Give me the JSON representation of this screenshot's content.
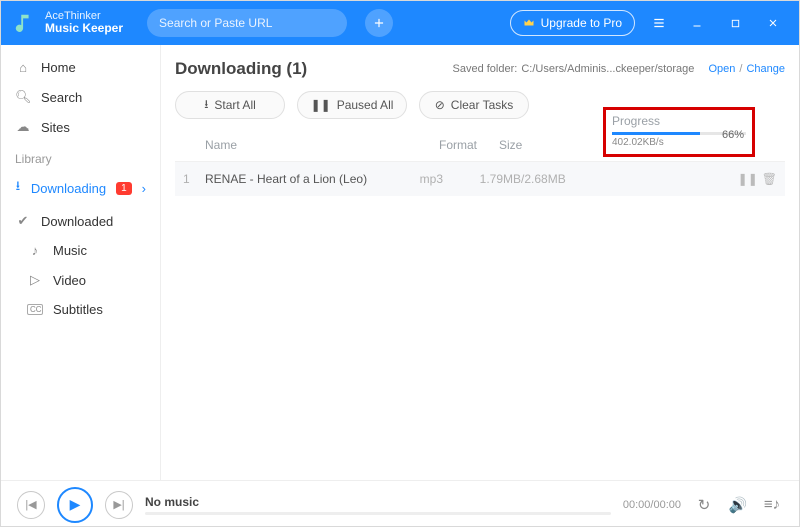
{
  "brand": {
    "line1": "AceThinker",
    "line2": "Music Keeper"
  },
  "search": {
    "placeholder": "Search or Paste URL"
  },
  "titlebar": {
    "upgrade": "Upgrade to Pro"
  },
  "sidebar": {
    "home": "Home",
    "search": "Search",
    "sites": "Sites",
    "library_label": "Library",
    "downloading": "Downloading",
    "downloading_badge": "1",
    "downloaded": "Downloaded",
    "music": "Music",
    "video": "Video",
    "subtitles": "Subtitles"
  },
  "page": {
    "title": "Downloading (1)",
    "saved_label": "Saved folder:",
    "saved_path": "C:/Users/Adminis...ckeeper/storage",
    "open": "Open",
    "change": "Change"
  },
  "toolbar": {
    "start_all": "Start All",
    "paused_all": "Paused All",
    "clear_tasks": "Clear Tasks"
  },
  "columns": {
    "name": "Name",
    "format": "Format",
    "size": "Size",
    "progress": "Progress"
  },
  "rows": [
    {
      "idx": "1",
      "name": "RENAE - Heart of a Lion (Leo)",
      "format": "mp3",
      "size": "1.79MB/2.68MB",
      "percent": "66%",
      "percent_width": "66%",
      "speed": "402.02KB/s"
    }
  ],
  "player": {
    "track": "No music",
    "time": "00:00/00:00"
  }
}
